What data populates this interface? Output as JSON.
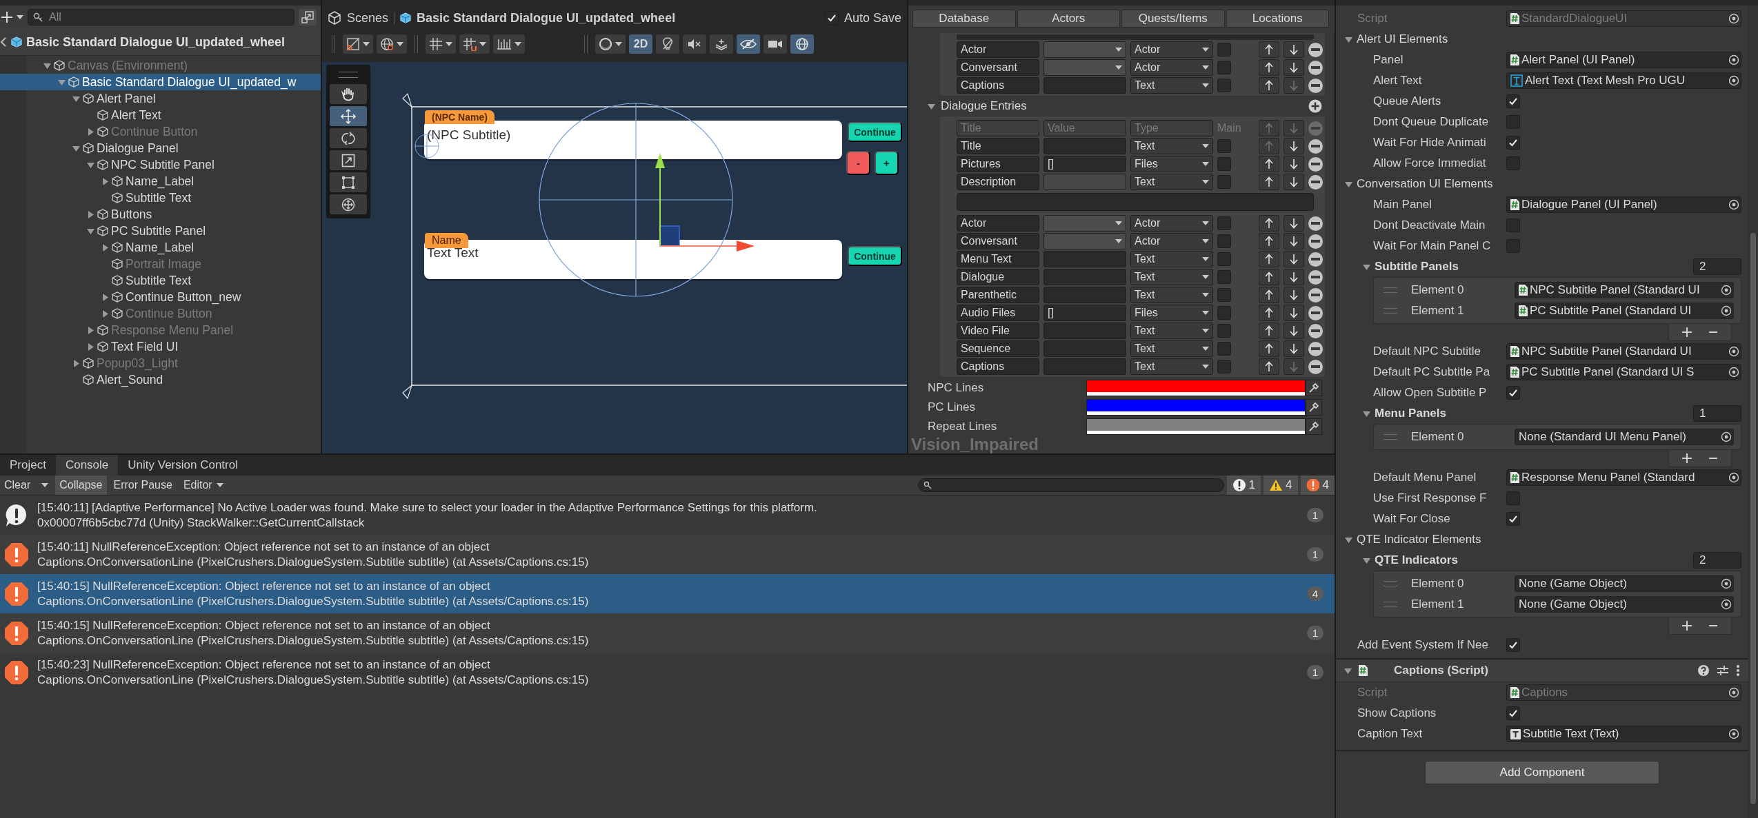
{
  "hierarchy": {
    "search": {
      "placeholder": "All"
    },
    "title": "Basic Standard Dialogue UI_updated_wheel",
    "items": [
      {
        "label": "Canvas (Environment)",
        "active": false,
        "selected": false,
        "expanded": true,
        "children": [
          {
            "label": "Basic Standard Dialogue UI_updated_w",
            "active": true,
            "selected": true,
            "expanded": true,
            "children": [
              {
                "label": "Alert Panel",
                "active": true,
                "selected": false,
                "expanded": true,
                "children": [
                  {
                    "label": "Alert Text",
                    "active": true,
                    "selected": false
                  },
                  {
                    "label": "Continue Button",
                    "active": false,
                    "selected": false,
                    "expanded": false
                  }
                ]
              },
              {
                "label": "Dialogue Panel",
                "active": true,
                "selected": false,
                "expanded": true,
                "children": [
                  {
                    "label": "NPC Subtitle Panel",
                    "active": true,
                    "selected": false,
                    "expanded": true,
                    "children": [
                      {
                        "label": "Name_Label",
                        "active": true,
                        "selected": false,
                        "expanded": false
                      },
                      {
                        "label": "Subtitle Text",
                        "active": true,
                        "selected": false
                      }
                    ]
                  },
                  {
                    "label": "Buttons",
                    "active": true,
                    "selected": false,
                    "expanded": false
                  },
                  {
                    "label": "PC Subtitle Panel",
                    "active": true,
                    "selected": false,
                    "expanded": true,
                    "children": [
                      {
                        "label": "Name_Label",
                        "active": true,
                        "selected": false,
                        "expanded": false
                      },
                      {
                        "label": "Portrait Image",
                        "active": false,
                        "selected": false
                      },
                      {
                        "label": "Subtitle Text",
                        "active": true,
                        "selected": false
                      },
                      {
                        "label": "Continue Button_new",
                        "active": true,
                        "selected": false,
                        "expanded": false
                      },
                      {
                        "label": "Continue Button",
                        "active": false,
                        "selected": false,
                        "expanded": false
                      }
                    ]
                  },
                  {
                    "label": "Response Menu Panel",
                    "active": false,
                    "selected": false,
                    "expanded": false
                  },
                  {
                    "label": "Text Field UI",
                    "active": true,
                    "selected": false,
                    "expanded": false
                  }
                ]
              },
              {
                "label": "Popup03_Light",
                "active": false,
                "selected": false,
                "expanded": false
              },
              {
                "label": "Alert_Sound",
                "active": true,
                "selected": false
              }
            ]
          }
        ]
      }
    ]
  },
  "scene": {
    "breadcrumb": "Scenes",
    "title": "Basic Standard Dialogue UI_updated_wheel",
    "auto_save": {
      "label": "Auto Save",
      "checked": true
    },
    "toggles": [
      {
        "kind": "dimension",
        "label": "2D",
        "selected": true
      },
      {
        "kind": "lighting",
        "selected": false
      },
      {
        "kind": "audio",
        "selected": false
      },
      {
        "kind": "effects",
        "selected": false
      },
      {
        "kind": "visibility",
        "selected": true
      },
      {
        "kind": "camera",
        "selected": false
      },
      {
        "kind": "gizmos",
        "selected": true
      }
    ],
    "tools": [
      {
        "kind": "hand",
        "selected": false
      },
      {
        "kind": "move",
        "selected": true
      },
      {
        "kind": "rotate",
        "selected": false
      },
      {
        "kind": "scale",
        "selected": false
      },
      {
        "kind": "rect",
        "selected": false
      },
      {
        "kind": "transform",
        "selected": false
      }
    ],
    "npc_panel": {
      "name": "(NPC Name)",
      "text": "(NPC Subtitle)",
      "button": "Continue",
      "minus": "-",
      "plus": "+"
    },
    "pc_panel": {
      "name": "Name",
      "text": "Text Text",
      "button": "Continue"
    }
  },
  "dialogue_editor": {
    "tabs": [
      {
        "label": "Database"
      },
      {
        "label": "Actors"
      },
      {
        "label": "Quests/Items"
      },
      {
        "label": "Locations"
      }
    ],
    "top_fields": [
      {
        "title": "Actor",
        "kind": "dropdown",
        "type": "Actor",
        "main": false,
        "can_move_up": true,
        "can_move_down": true
      },
      {
        "title": "Conversant",
        "kind": "dropdown",
        "type": "Actor",
        "main": false,
        "can_move_up": true,
        "can_move_down": true
      },
      {
        "title": "Captions",
        "kind": "text",
        "type": "Text",
        "main": false,
        "can_move_up": true,
        "can_move_down": false
      }
    ],
    "entries": {
      "label": "Dialogue Entries",
      "expanded": true,
      "columns": [
        "Title",
        "Value",
        "Type",
        "Main"
      ],
      "fields_before": [
        {
          "title": "Title",
          "kind": "text",
          "type": "Text",
          "main": false,
          "can_move_up": false,
          "can_move_down": true
        },
        {
          "title": "Pictures",
          "kind": "text",
          "value": "[]",
          "type": "Files",
          "main": false,
          "can_move_up": true,
          "can_move_down": true
        },
        {
          "title": "Description",
          "kind": "multiline",
          "type": "Text",
          "main": false,
          "can_move_up": true,
          "can_move_down": true
        }
      ],
      "fields_after": [
        {
          "title": "Actor",
          "kind": "dropdown",
          "type": "Actor",
          "main": false,
          "can_move_up": true,
          "can_move_down": true
        },
        {
          "title": "Conversant",
          "kind": "dropdown",
          "type": "Actor",
          "main": false,
          "can_move_up": true,
          "can_move_down": true
        },
        {
          "title": "Menu Text",
          "kind": "text",
          "type": "Text",
          "main": false,
          "can_move_up": true,
          "can_move_down": true
        },
        {
          "title": "Dialogue",
          "kind": "text",
          "type": "Text",
          "main": false,
          "can_move_up": true,
          "can_move_down": true
        },
        {
          "title": "Parenthetic",
          "kind": "text",
          "type": "Text",
          "main": false,
          "can_move_up": true,
          "can_move_down": true
        },
        {
          "title": "Audio Files",
          "kind": "text",
          "value": "[]",
          "type": "Files",
          "main": false,
          "can_move_up": true,
          "can_move_down": true
        },
        {
          "title": "Video File",
          "kind": "text",
          "type": "Text",
          "main": false,
          "can_move_up": true,
          "can_move_down": true
        },
        {
          "title": "Sequence",
          "kind": "text",
          "type": "Text",
          "main": false,
          "can_move_up": true,
          "can_move_down": true
        },
        {
          "title": "Captions",
          "kind": "text",
          "type": "Text",
          "main": false,
          "can_move_up": true,
          "can_move_down": false
        }
      ]
    },
    "line_colors": [
      {
        "label": "NPC Lines",
        "color": "#ff0000"
      },
      {
        "label": "PC Lines",
        "color": "#0000ff"
      },
      {
        "label": "Repeat Lines",
        "color": "#808080"
      }
    ],
    "database_name": "Vision_Impaired"
  },
  "console": {
    "tabs": [
      {
        "label": "Project",
        "selected": false
      },
      {
        "label": "Console",
        "selected": true
      },
      {
        "label": "Unity Version Control",
        "selected": false
      }
    ],
    "clear": "Clear",
    "collapse": {
      "label": "Collapse",
      "on": true
    },
    "error_pause": {
      "label": "Error Pause",
      "on": false
    },
    "editor": "Editor",
    "counts": {
      "info": "1",
      "warning": "4",
      "error": "4"
    },
    "entries": [
      {
        "kind": "info",
        "message": "[15:40:11] [Adaptive Performance] No Active Loader was found. Make sure to select your loader in the Adaptive Performance Settings for this platform.",
        "trace": "0x00007ff6b5cbc77d (Unity) StackWalker::GetCurrentCallstack",
        "count": "1",
        "selected": false
      },
      {
        "kind": "error",
        "message": "[15:40:11] NullReferenceException: Object reference not set to an instance of an object",
        "trace": "Captions.OnConversationLine (PixelCrushers.DialogueSystem.Subtitle subtitle) (at Assets/Captions.cs:15)",
        "count": "1",
        "selected": false
      },
      {
        "kind": "error",
        "message": "[15:40:15] NullReferenceException: Object reference not set to an instance of an object",
        "trace": "Captions.OnConversationLine (PixelCrushers.DialogueSystem.Subtitle subtitle) (at Assets/Captions.cs:15)",
        "count": "4",
        "selected": true
      },
      {
        "kind": "error",
        "message": "[15:40:15] NullReferenceException: Object reference not set to an instance of an object",
        "trace": "Captions.OnConversationLine (PixelCrushers.DialogueSystem.Subtitle subtitle) (at Assets/Captions.cs:15)",
        "count": "1",
        "selected": false
      },
      {
        "kind": "error",
        "message": "[15:40:23] NullReferenceException: Object reference not set to an instance of an object",
        "trace": "Captions.OnConversationLine (PixelCrushers.DialogueSystem.Subtitle subtitle) (at Assets/Captions.cs:15)",
        "count": "1",
        "selected": false
      }
    ]
  },
  "inspector": {
    "rows": [
      {
        "kind": "script",
        "label": "Script",
        "value": "StandardDialogueUI"
      },
      {
        "kind": "section",
        "label": "Alert UI Elements",
        "expanded": true,
        "children": [
          {
            "kind": "object",
            "label": "Panel",
            "value": "Alert Panel (UI Panel)"
          },
          {
            "kind": "tmpobject",
            "label": "Alert Text",
            "value": "Alert Text (Text Mesh Pro UGU"
          },
          {
            "kind": "toggle",
            "label": "Queue Alerts",
            "checked": true
          },
          {
            "kind": "toggle",
            "label": "Dont Queue Duplicate",
            "checked": false
          },
          {
            "kind": "toggle",
            "label": "Wait For Hide Animati",
            "checked": true
          },
          {
            "kind": "toggle",
            "label": "Allow Force Immediat",
            "checked": false
          }
        ]
      },
      {
        "kind": "section",
        "label": "Conversation UI Elements",
        "expanded": true,
        "children": [
          {
            "kind": "object",
            "label": "Main Panel",
            "value": "Dialogue Panel (UI Panel)"
          },
          {
            "kind": "toggle",
            "label": "Dont Deactivate Main",
            "checked": false
          },
          {
            "kind": "toggle",
            "label": "Wait For Main Panel C",
            "checked": false
          },
          {
            "kind": "list",
            "label": "Subtitle Panels",
            "size": "2",
            "expanded": true,
            "elements": [
              {
                "kind": "object",
                "label": "Element 0",
                "value": "NPC Subtitle Panel (Standard UI"
              },
              {
                "kind": "object",
                "label": "Element 1",
                "value": "PC Subtitle Panel (Standard UI"
              }
            ]
          },
          {
            "kind": "object",
            "label": "Default NPC Subtitle",
            "value": "NPC Subtitle Panel (Standard UI"
          },
          {
            "kind": "object",
            "label": "Default PC Subtitle Pa",
            "value": "PC Subtitle Panel (Standard UI S"
          },
          {
            "kind": "toggle",
            "label": "Allow Open Subtitle P",
            "checked": true
          },
          {
            "kind": "list",
            "label": "Menu Panels",
            "size": "1",
            "expanded": true,
            "elements": [
              {
                "kind": "emptyobject",
                "label": "Element 0",
                "value": "None (Standard UI Menu Panel)"
              }
            ]
          },
          {
            "kind": "object",
            "label": "Default Menu Panel",
            "value": "Response Menu Panel (Standard"
          },
          {
            "kind": "toggle",
            "label": "Use First Response F",
            "checked": false
          },
          {
            "kind": "toggle",
            "label": "Wait For Close",
            "checked": true
          }
        ]
      },
      {
        "kind": "section",
        "label": "QTE Indicator Elements",
        "expanded": true,
        "children": [
          {
            "kind": "list",
            "label": "QTE Indicators",
            "size": "2",
            "expanded": true,
            "elements": [
              {
                "kind": "emptyobject",
                "label": "Element 0",
                "value": "None (Game Object)"
              },
              {
                "kind": "emptyobject",
                "label": "Element 1",
                "value": "None (Game Object)"
              }
            ]
          }
        ]
      },
      {
        "kind": "toggle",
        "label": "Add Event System If Nee",
        "checked": true
      },
      {
        "kind": "component",
        "label": "Captions (Script)",
        "expanded": true,
        "children": [
          {
            "kind": "script",
            "label": "Script",
            "value": "Captions"
          },
          {
            "kind": "toggle",
            "label": "Show Captions",
            "checked": true
          },
          {
            "kind": "textobject",
            "label": "Caption Text",
            "value": "Subtitle Text (Text)"
          }
        ]
      }
    ],
    "add_component": "Add Component"
  }
}
